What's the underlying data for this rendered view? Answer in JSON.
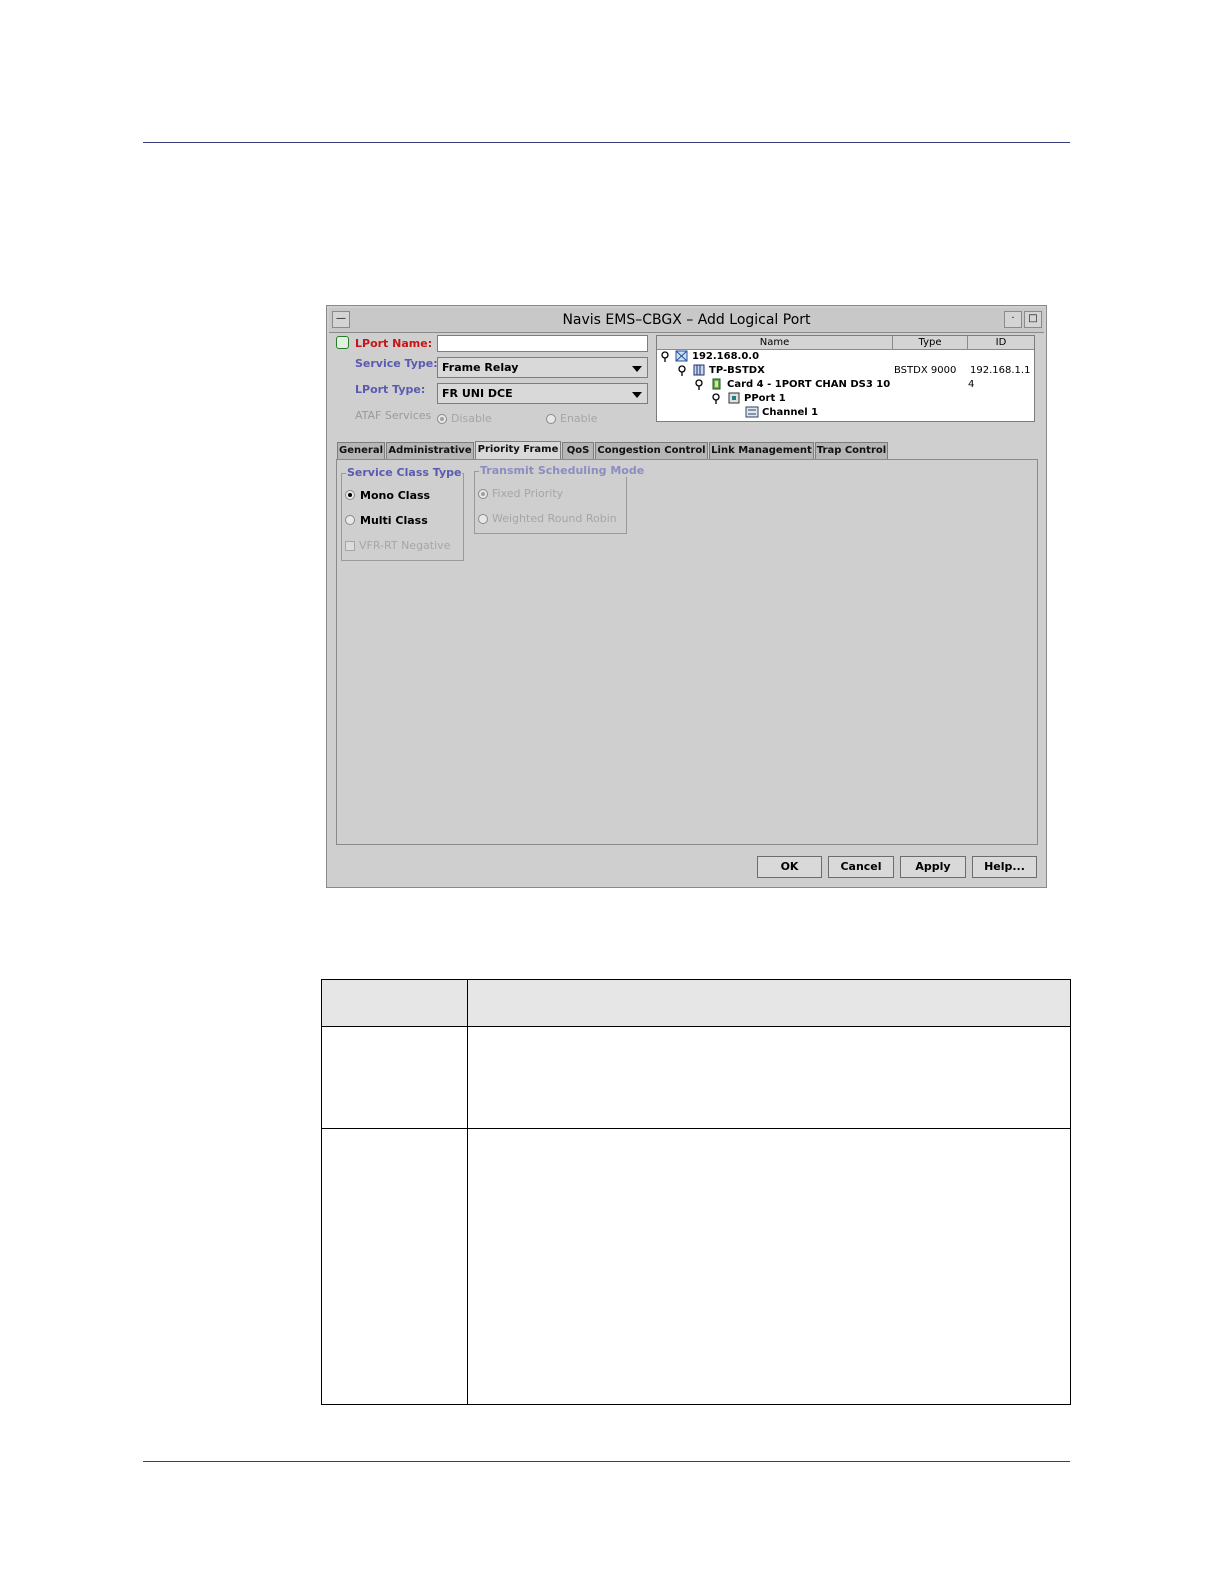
{
  "window": {
    "title": "Navis EMS–CBGX – Add Logical Port"
  },
  "form": {
    "lport_name_label": "LPort Name:",
    "lport_name_value": "",
    "service_type_label": "Service Type:",
    "service_type_value": "Frame Relay",
    "lport_type_label": "LPort Type:",
    "lport_type_value": "FR UNI DCE",
    "ataf_label": "ATAF Services",
    "ataf_disable": "Disable",
    "ataf_enable": "Enable"
  },
  "tree": {
    "headers": [
      "Name",
      "Type",
      "ID"
    ],
    "rows": [
      {
        "name": "192.168.0.0",
        "type": "",
        "id": ""
      },
      {
        "name": "TP-BSTDX",
        "type": "BSTDX 9000",
        "id": "192.168.1.1"
      },
      {
        "name": "Card 4 - 1PORT CHAN DS3 10",
        "type": "",
        "id": "4"
      },
      {
        "name": "PPort 1",
        "type": "",
        "id": ""
      },
      {
        "name": "Channel 1",
        "type": "",
        "id": ""
      }
    ]
  },
  "tabs": [
    "General",
    "Administrative",
    "Priority Frame",
    "QoS",
    "Congestion Control",
    "Link Management",
    "Trap Control"
  ],
  "active_tab": "Priority Frame",
  "service_class": {
    "title": "Service Class Type",
    "mono": "Mono Class",
    "multi": "Multi Class",
    "vfr": "VFR-RT Negative"
  },
  "transmit": {
    "title": "Transmit Scheduling Mode",
    "fixed": "Fixed Priority",
    "wrr": "Weighted Round Robin"
  },
  "buttons": {
    "ok": "OK",
    "cancel": "Cancel",
    "apply": "Apply",
    "help": "Help..."
  }
}
